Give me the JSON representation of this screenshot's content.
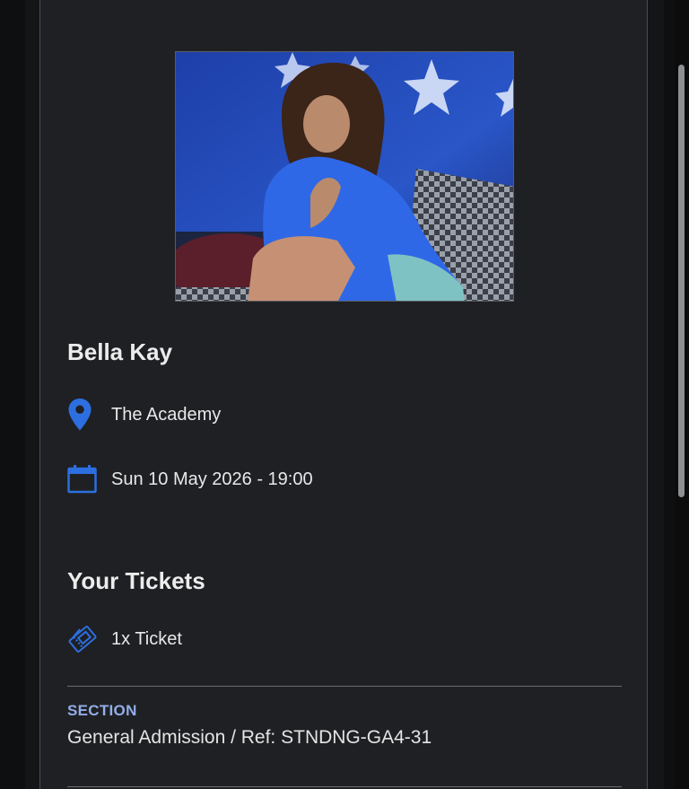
{
  "event": {
    "title": "Bella Kay",
    "venue": "The Academy",
    "datetime": "Sun 10 May 2026 - 19:00"
  },
  "tickets": {
    "heading": "Your Tickets",
    "count_label": "1x Ticket"
  },
  "section": {
    "label": "SECTION",
    "value": "General Admission / Ref: STNDNG-GA4-31"
  },
  "icons": {
    "location": "map-pin-icon",
    "date": "calendar-icon",
    "ticket": "ticket-icon"
  },
  "colors": {
    "accent": "#2d6fe0",
    "card_background": "#1f2023",
    "section_label": "#93aee8",
    "text": "#ececec"
  }
}
